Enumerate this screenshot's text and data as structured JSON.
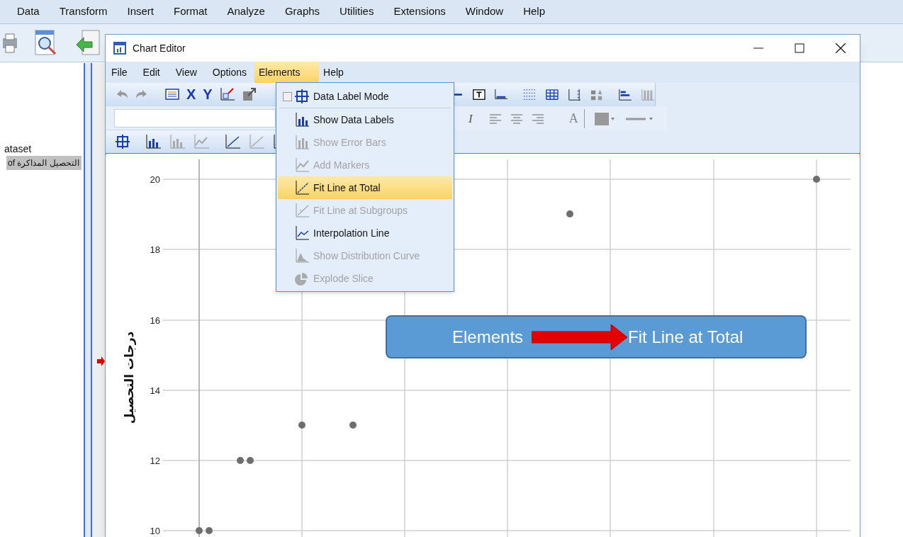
{
  "app_menu": [
    "Data",
    "Transform",
    "Insert",
    "Format",
    "Analyze",
    "Graphs",
    "Utilities",
    "Extensions",
    "Window",
    "Help"
  ],
  "left_panel": {
    "heading": "ataset",
    "item": {
      "label": "of التحصيل المذاكرة",
      "selected": true
    }
  },
  "chart_editor": {
    "title": "Chart Editor",
    "menu": [
      {
        "label": "File",
        "selected": false
      },
      {
        "label": "Edit",
        "selected": false
      },
      {
        "label": "View",
        "selected": false
      },
      {
        "label": "Options",
        "selected": false
      },
      {
        "label": "Elements",
        "selected": true
      },
      {
        "label": "Help",
        "selected": false
      }
    ],
    "toolbar_glyphs": {
      "x_axis": "X",
      "y_axis": "Y",
      "italic": "I",
      "font": "A"
    },
    "elements_menu": [
      {
        "kind": "checkbox",
        "label": "Data Label Mode",
        "checked": false,
        "disabled": false,
        "selected": false
      },
      {
        "kind": "item",
        "label": "Show Data Labels",
        "disabled": false,
        "selected": false
      },
      {
        "kind": "item",
        "label": "Show Error Bars",
        "disabled": true,
        "selected": false
      },
      {
        "kind": "item",
        "label": "Add Markers",
        "disabled": true,
        "selected": false
      },
      {
        "kind": "item",
        "label": "Fit Line at Total",
        "disabled": false,
        "selected": true
      },
      {
        "kind": "item",
        "label": "Fit Line at Subgroups",
        "disabled": true,
        "selected": false
      },
      {
        "kind": "item",
        "label": "Interpolation Line",
        "disabled": false,
        "selected": false
      },
      {
        "kind": "item",
        "label": "Show Distribution Curve",
        "disabled": true,
        "selected": false
      },
      {
        "kind": "item",
        "label": "Explode Slice",
        "disabled": true,
        "selected": false
      }
    ],
    "chart": {
      "y_title": "درجات التحصيل",
      "y_ticks": [
        "20",
        "18",
        "16",
        "14",
        "12",
        "10"
      ]
    }
  },
  "callout": {
    "from": "Elements",
    "to": "Fit Line at Total"
  }
}
